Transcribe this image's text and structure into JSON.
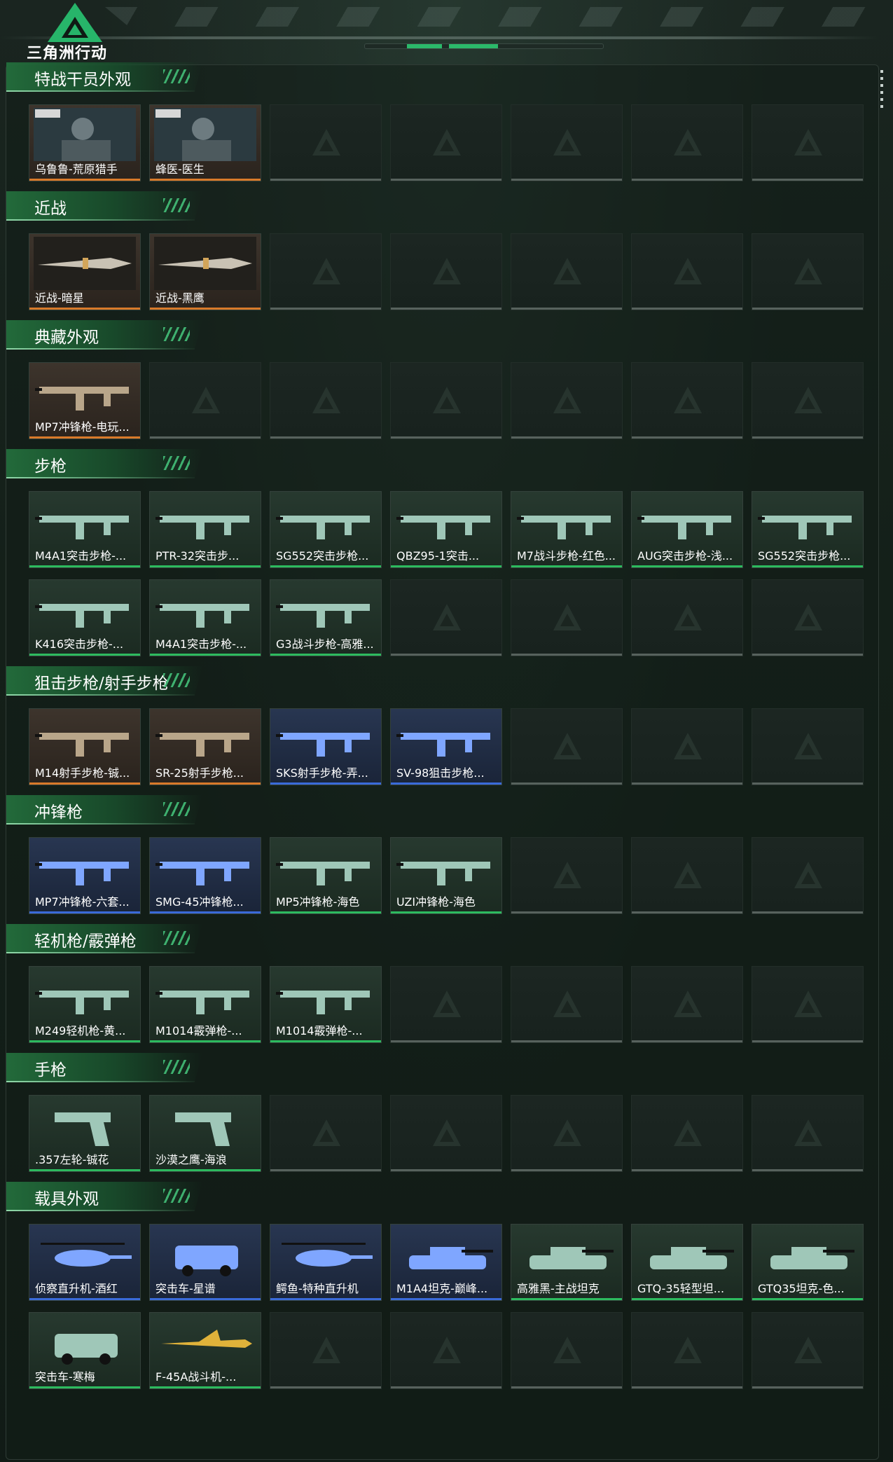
{
  "app": {
    "logo_text": "三角洲行动"
  },
  "colors": {
    "accent_green": "#2dbb5f",
    "rarity_orange": "#d97a2a",
    "rarity_blue": "#3a6ad9",
    "rarity_green": "#2dbb5f"
  },
  "sections": [
    {
      "title": "特战干员外观",
      "items": [
        {
          "name": "乌鲁鲁-荒原猎手",
          "rarity": "orange",
          "icon": "operator-portrait"
        },
        {
          "name": "蜂医-医生",
          "rarity": "orange",
          "icon": "operator-portrait"
        }
      ]
    },
    {
      "title": "近战",
      "items": [
        {
          "name": "近战-暗星",
          "rarity": "orange",
          "icon": "knife"
        },
        {
          "name": "近战-黑鹰",
          "rarity": "orange",
          "icon": "knife"
        }
      ]
    },
    {
      "title": "典藏外观",
      "items": [
        {
          "name": "MP7冲锋枪-电玩...",
          "rarity": "orange",
          "icon": "smg"
        }
      ]
    },
    {
      "title": "步枪",
      "items": [
        {
          "name": "M4A1突击步枪-...",
          "rarity": "green",
          "icon": "rifle"
        },
        {
          "name": "PTR-32突击步...",
          "rarity": "green",
          "icon": "rifle"
        },
        {
          "name": "SG552突击步枪...",
          "rarity": "green",
          "icon": "rifle"
        },
        {
          "name": "QBZ95-1突击...",
          "rarity": "green",
          "icon": "rifle"
        },
        {
          "name": "M7战斗步枪-红色...",
          "rarity": "green",
          "icon": "rifle"
        },
        {
          "name": "AUG突击步枪-浅...",
          "rarity": "green",
          "icon": "rifle"
        },
        {
          "name": "SG552突击步枪...",
          "rarity": "green",
          "icon": "rifle"
        },
        {
          "name": "K416突击步枪-...",
          "rarity": "green",
          "icon": "rifle"
        },
        {
          "name": "M4A1突击步枪-...",
          "rarity": "green",
          "icon": "rifle"
        },
        {
          "name": "G3战斗步枪-高雅...",
          "rarity": "green",
          "icon": "rifle"
        }
      ]
    },
    {
      "title": "狙击步枪/射手步枪",
      "items": [
        {
          "name": "M14射手步枪-铖...",
          "rarity": "orange",
          "icon": "sniper-rifle"
        },
        {
          "name": "SR-25射手步枪...",
          "rarity": "orange",
          "icon": "sniper-rifle"
        },
        {
          "name": "SKS射手步枪-弄...",
          "rarity": "blue",
          "icon": "sniper-rifle"
        },
        {
          "name": "SV-98狙击步枪...",
          "rarity": "blue",
          "icon": "sniper-rifle"
        }
      ]
    },
    {
      "title": "冲锋枪",
      "items": [
        {
          "name": "MP7冲锋枪-六套...",
          "rarity": "blue",
          "icon": "smg"
        },
        {
          "name": "SMG-45冲锋枪...",
          "rarity": "blue",
          "icon": "smg"
        },
        {
          "name": "MP5冲锋枪-海色",
          "rarity": "green",
          "icon": "smg"
        },
        {
          "name": "UZI冲锋枪-海色",
          "rarity": "green",
          "icon": "smg"
        }
      ]
    },
    {
      "title": "轻机枪/霰弹枪",
      "items": [
        {
          "name": "M249轻机枪-黄...",
          "rarity": "green",
          "icon": "lmg"
        },
        {
          "name": "M1014霰弹枪-...",
          "rarity": "green",
          "icon": "shotgun"
        },
        {
          "name": "M1014霰弹枪-...",
          "rarity": "green",
          "icon": "shotgun"
        }
      ]
    },
    {
      "title": "手枪",
      "items": [
        {
          "name": ".357左轮-铖花",
          "rarity": "green",
          "icon": "pistol"
        },
        {
          "name": "沙漠之鹰-海浪",
          "rarity": "green",
          "icon": "pistol"
        }
      ]
    },
    {
      "title": "载具外观",
      "items": [
        {
          "name": "侦察直升机-酒红",
          "rarity": "blue",
          "icon": "helicopter"
        },
        {
          "name": "突击车-星谱",
          "rarity": "blue",
          "icon": "vehicle"
        },
        {
          "name": "鳄鱼-特种直升机",
          "rarity": "blue",
          "icon": "helicopter"
        },
        {
          "name": "M1A4坦克-巅峰...",
          "rarity": "blue",
          "icon": "tank"
        },
        {
          "name": "高雅黑-主战坦克",
          "rarity": "green",
          "icon": "tank"
        },
        {
          "name": "GTQ-35轻型坦...",
          "rarity": "green",
          "icon": "tank"
        },
        {
          "name": "GTQ35坦克-色...",
          "rarity": "green",
          "icon": "tank"
        },
        {
          "name": "突击车-寒梅",
          "rarity": "green",
          "icon": "vehicle"
        },
        {
          "name": "F-45A战斗机-...",
          "rarity": "green",
          "icon": "jet"
        }
      ]
    }
  ]
}
